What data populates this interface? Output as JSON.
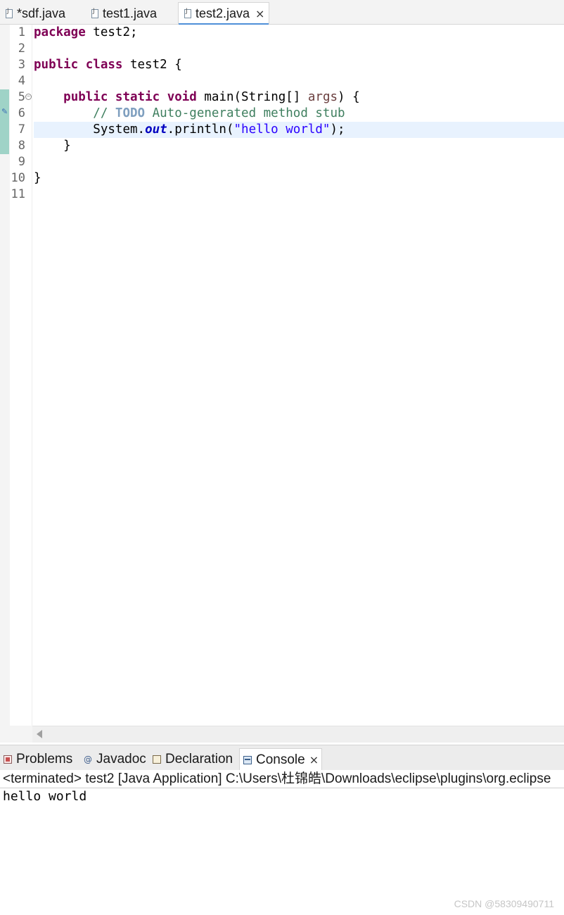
{
  "editor_tabs": [
    {
      "label": "*sdf.java",
      "icon": "java-file-icon",
      "active": false
    },
    {
      "label": "test1.java",
      "icon": "java-file-icon",
      "active": false
    },
    {
      "label": "test2.java",
      "icon": "java-file-icon",
      "active": true,
      "close": "×"
    }
  ],
  "line_numbers": [
    "1",
    "2",
    "3",
    "4",
    "5",
    "6",
    "7",
    "8",
    "9",
    "10",
    "11"
  ],
  "code": {
    "l1": {
      "kw": "package",
      "rest": " test2;"
    },
    "l3": {
      "kw1": "public",
      "kw2": "class",
      "rest": " test2 {"
    },
    "l5": {
      "indent": "    ",
      "kw1": "public",
      "kw2": "static",
      "kw3": "void",
      "name": " main(String[] ",
      "param": "args",
      "rest": ") {"
    },
    "l6": {
      "indent": "        ",
      "comment_start": "// ",
      "todo": "TODO",
      "comment_rest": " Auto-generated method stub"
    },
    "l7": {
      "indent": "        ",
      "cls": "System.",
      "field": "out",
      "call": ".println(",
      "string": "\"hello world\"",
      "end": ");"
    },
    "l8": {
      "text": "    }"
    },
    "l10": {
      "text": "}"
    }
  },
  "colors": {
    "keyword": "#7f0055",
    "comment": "#3f7f5f",
    "string": "#2a00ff",
    "field": "#0000c0",
    "current_line": "#e8f2fe",
    "active_tab_underline": "#4f8fd8"
  },
  "view_tabs": [
    {
      "label": "Problems",
      "icon": "problems-icon"
    },
    {
      "label": "Javadoc",
      "icon": "javadoc-icon",
      "glyph": "@"
    },
    {
      "label": "Declaration",
      "icon": "declaration-icon"
    },
    {
      "label": "Console",
      "icon": "console-icon",
      "active": true,
      "close": "×"
    }
  ],
  "console": {
    "header": "<terminated> test2 [Java Application] C:\\Users\\杜锦皓\\Downloads\\eclipse\\plugins\\org.eclipse",
    "output": "hello world"
  },
  "watermark": "CSDN @58309490711"
}
